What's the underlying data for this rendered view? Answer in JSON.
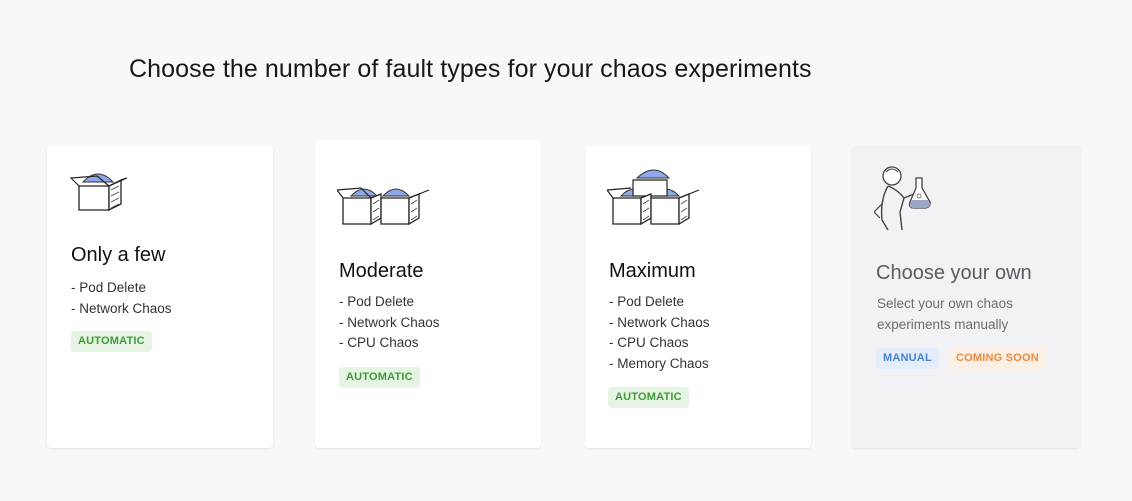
{
  "header": {
    "title": "Choose the number of fault types for your chaos experiments"
  },
  "cards": [
    {
      "heading": "Only a few",
      "items": [
        "- Pod Delete",
        "- Network Chaos"
      ],
      "badge": "AUTOMATIC",
      "icon": "single-box-icon"
    },
    {
      "heading": "Moderate",
      "items": [
        "- Pod Delete",
        "- Network Chaos",
        "- CPU Chaos"
      ],
      "badge": "AUTOMATIC",
      "icon": "two-boxes-icon"
    },
    {
      "heading": "Maximum",
      "items": [
        "- Pod Delete",
        "- Network Chaos",
        "- CPU Chaos",
        "- Memory Chaos"
      ],
      "badge": "AUTOMATIC",
      "icon": "stacked-boxes-icon"
    },
    {
      "heading": "Choose your own",
      "description": "Select your own chaos experiments manually",
      "badges": [
        "MANUAL",
        "COMING SOON"
      ],
      "icon": "scientist-icon"
    }
  ],
  "colors": {
    "automatic_badge": "#3f9a3b",
    "manual_badge": "#4a7fd6",
    "coming_soon_badge": "#ea8a43",
    "box_blob": "#8fa9e8"
  }
}
